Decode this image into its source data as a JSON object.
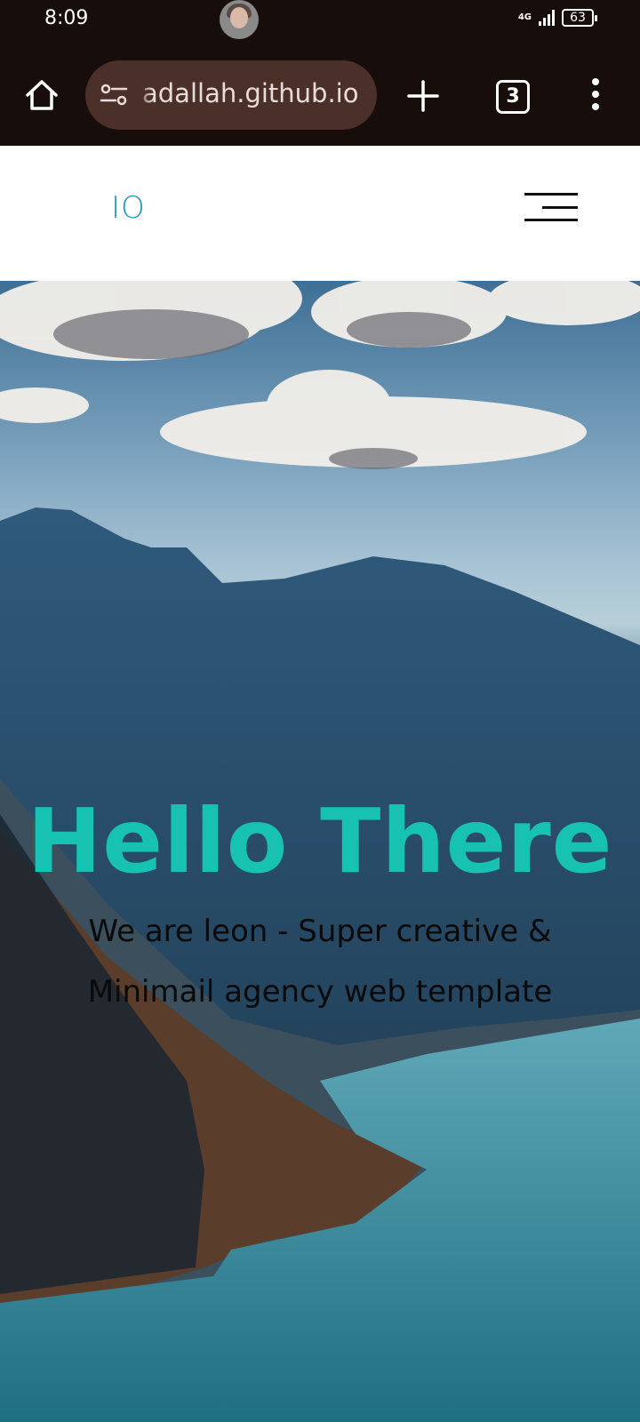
{
  "status_bar": {
    "time": "8:09",
    "network": "4G",
    "battery": "63"
  },
  "browser": {
    "url": "adallah.github.io",
    "tab_count": "3"
  },
  "site": {
    "logo": "IO"
  },
  "hero": {
    "title": "Hello There",
    "subtitle_line1": "We are leon - Super creative &",
    "subtitle_line2": "Minimail agency web template"
  },
  "colors": {
    "accent": "#17c2b2",
    "logo": "#1b9ab3",
    "browser_bar": "#170d0b",
    "url_pill": "#4a3029"
  }
}
